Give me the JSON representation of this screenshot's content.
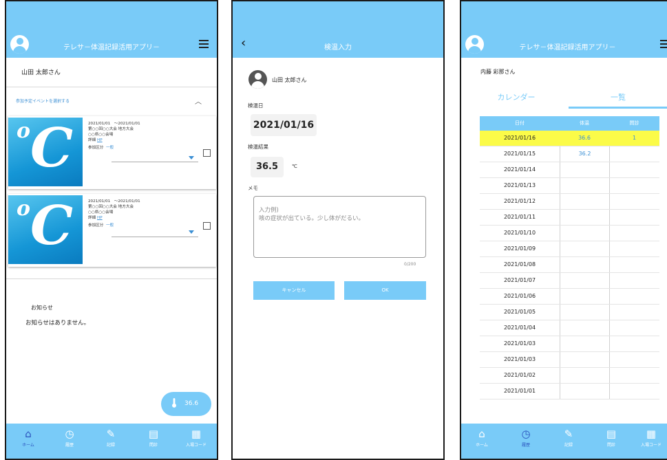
{
  "home": {
    "app_title": "テレサ－体温記録活用アプリ－",
    "user_name": "山田 太郎さん",
    "event_selector_label": "参加予定イベントを選択する",
    "events": [
      {
        "date_range": "2021/01/01　～2021/01/01",
        "event_name": "第○○回○○大会 地方大会",
        "venue": "○○県○○会場",
        "detail_label": "詳細",
        "detail_link": "HP",
        "category_label": "参加区分",
        "category_value": "一般"
      },
      {
        "date_range": "2021/01/01　～2021/01/01",
        "event_name": "第○○回○○大会 地方大会",
        "venue": "○○県○○会場",
        "detail_label": "詳細",
        "detail_link": "HP",
        "category_label": "参加区分",
        "category_value": "一般"
      }
    ],
    "notice_title": "お知らせ",
    "notice_text": "お知らせはありません。",
    "fab_value": "36.6"
  },
  "input": {
    "title": "検温入力",
    "user_name": "山田 太郎さん",
    "date_label": "検温日",
    "date_value": "2021/01/16",
    "result_label": "検温結果",
    "result_value": "36.5",
    "unit": "℃",
    "memo_label": "メモ",
    "memo_placeholder_line1": "入力例)",
    "memo_placeholder_line2": "咳の症状が出ている。少し体がだるい。",
    "counter": "0/200",
    "cancel_label": "キャンセル",
    "ok_label": "OK"
  },
  "history": {
    "app_title": "テレサ－体温記録活用アプリ－",
    "user_name": "内藤 彩那さん",
    "tabs": [
      "カレンダー",
      "一覧"
    ],
    "headers": [
      "日付",
      "体温",
      "問診"
    ],
    "rows": [
      [
        "2021/01/16",
        "36.6",
        "1"
      ],
      [
        "2021/01/15",
        "36.2",
        ""
      ],
      [
        "2021/01/14",
        "",
        ""
      ],
      [
        "2021/01/13",
        "",
        ""
      ],
      [
        "2021/01/12",
        "",
        ""
      ],
      [
        "2021/01/11",
        "",
        ""
      ],
      [
        "2021/01/10",
        "",
        ""
      ],
      [
        "2021/01/09",
        "",
        ""
      ],
      [
        "2021/01/08",
        "",
        ""
      ],
      [
        "2021/01/07",
        "",
        ""
      ],
      [
        "2021/01/06",
        "",
        ""
      ],
      [
        "2021/01/05",
        "",
        ""
      ],
      [
        "2021/01/04",
        "",
        ""
      ],
      [
        "2021/01/03",
        "",
        ""
      ],
      [
        "2021/01/03",
        "",
        ""
      ],
      [
        "2021/01/02",
        "",
        ""
      ],
      [
        "2021/01/01",
        "",
        ""
      ]
    ]
  },
  "nav": {
    "items": [
      {
        "label": "ホーム",
        "icon": "home-icon"
      },
      {
        "label": "履歴",
        "icon": "clock-icon"
      },
      {
        "label": "記録",
        "icon": "pencil-icon"
      },
      {
        "label": "問診",
        "icon": "questionnaire-icon"
      },
      {
        "label": "入場コード",
        "icon": "qr-code-icon"
      }
    ]
  },
  "colors": {
    "primary": "#79cbf8",
    "highlight": "#fbfb48",
    "active_nav": "#2a52be",
    "link": "#3b8fd4"
  }
}
